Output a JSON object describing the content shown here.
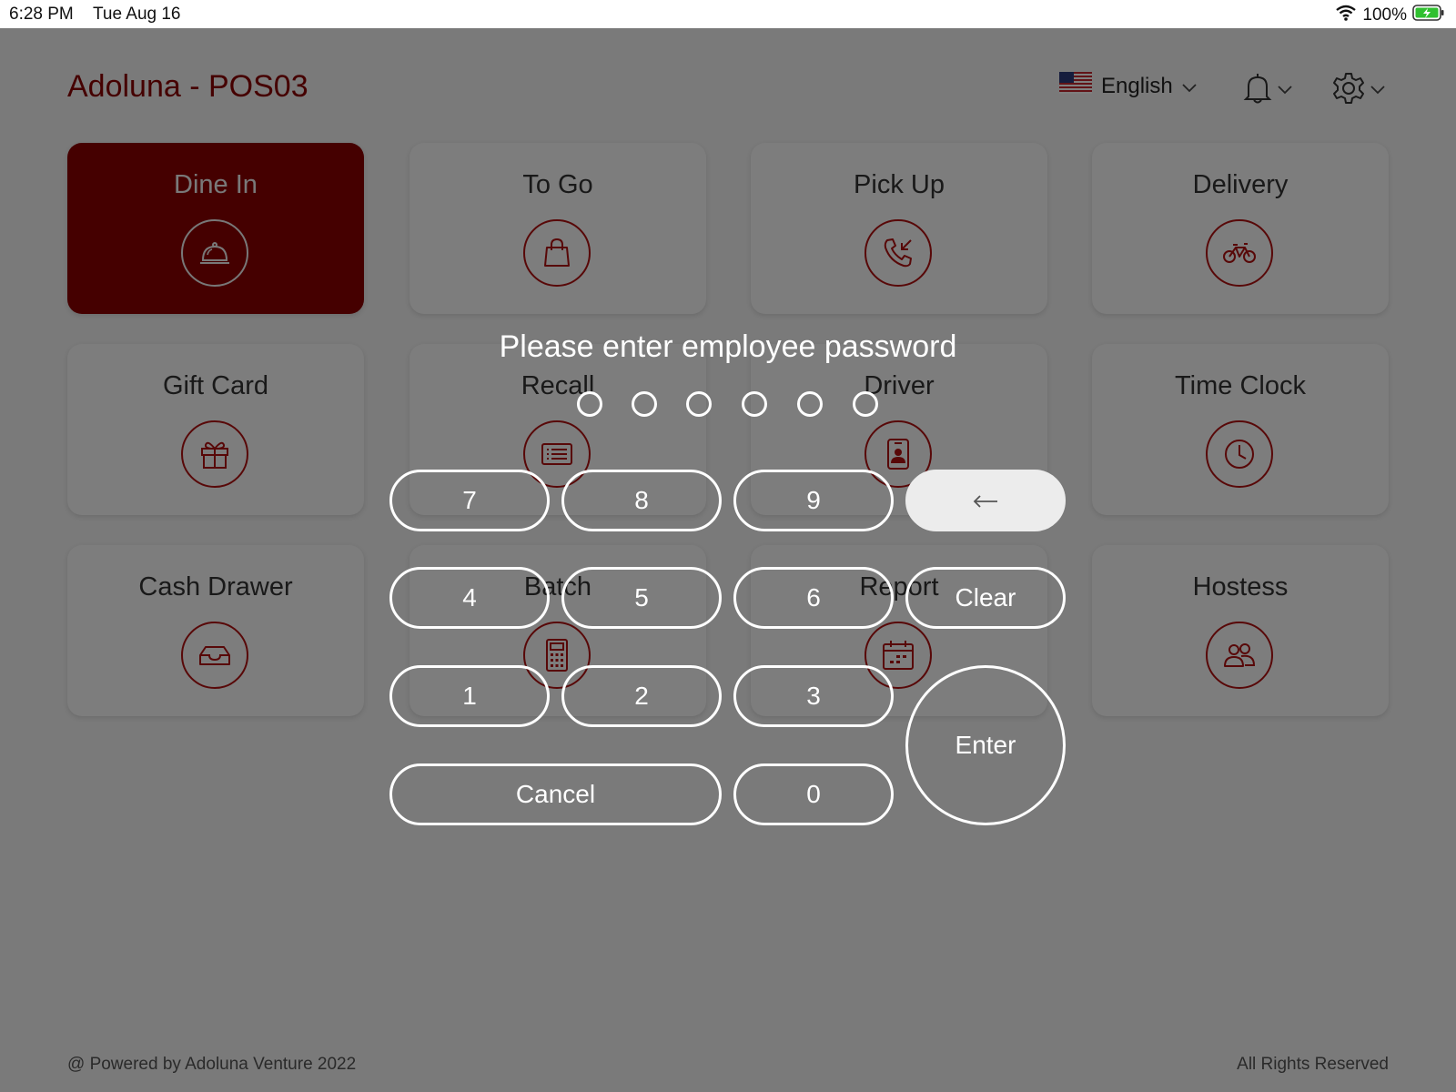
{
  "status_bar": {
    "time": "6:28 PM",
    "date": "Tue Aug 16",
    "battery": "100%"
  },
  "header": {
    "title": "Adoluna - POS03",
    "language": "English"
  },
  "tiles": [
    {
      "label": "Dine In",
      "icon": "service-bell-icon",
      "active": true
    },
    {
      "label": "To Go",
      "icon": "shopping-bag-icon"
    },
    {
      "label": "Pick Up",
      "icon": "phone-incoming-icon"
    },
    {
      "label": "Delivery",
      "icon": "bicycle-icon"
    },
    {
      "label": "Gift Card",
      "icon": "gift-icon"
    },
    {
      "label": "Recall",
      "icon": "list-icon"
    },
    {
      "label": "Driver",
      "icon": "id-badge-icon"
    },
    {
      "label": "Time Clock",
      "icon": "clock-icon"
    },
    {
      "label": "Cash Drawer",
      "icon": "drawer-icon"
    },
    {
      "label": "Batch",
      "icon": "calculator-icon"
    },
    {
      "label": "Report",
      "icon": "calendar-icon"
    },
    {
      "label": "Hostess",
      "icon": "users-icon"
    }
  ],
  "footer": {
    "left": "@ Powered by Adoluna Venture 2022",
    "right": "All Rights Reserved"
  },
  "dialog": {
    "prompt": "Please enter employee password",
    "pin_length": 6,
    "pin_entered": 0,
    "keys": {
      "k7": "7",
      "k8": "8",
      "k9": "9",
      "back": "←",
      "k4": "4",
      "k5": "5",
      "k6": "6",
      "clear": "Clear",
      "k1": "1",
      "k2": "2",
      "k3": "3",
      "enter": "Enter",
      "cancel": "Cancel",
      "k0": "0"
    }
  },
  "colors": {
    "brand": "#8b0000",
    "icon_stroke": "#b01010",
    "overlay": "rgba(0,0,0,0.5)"
  }
}
